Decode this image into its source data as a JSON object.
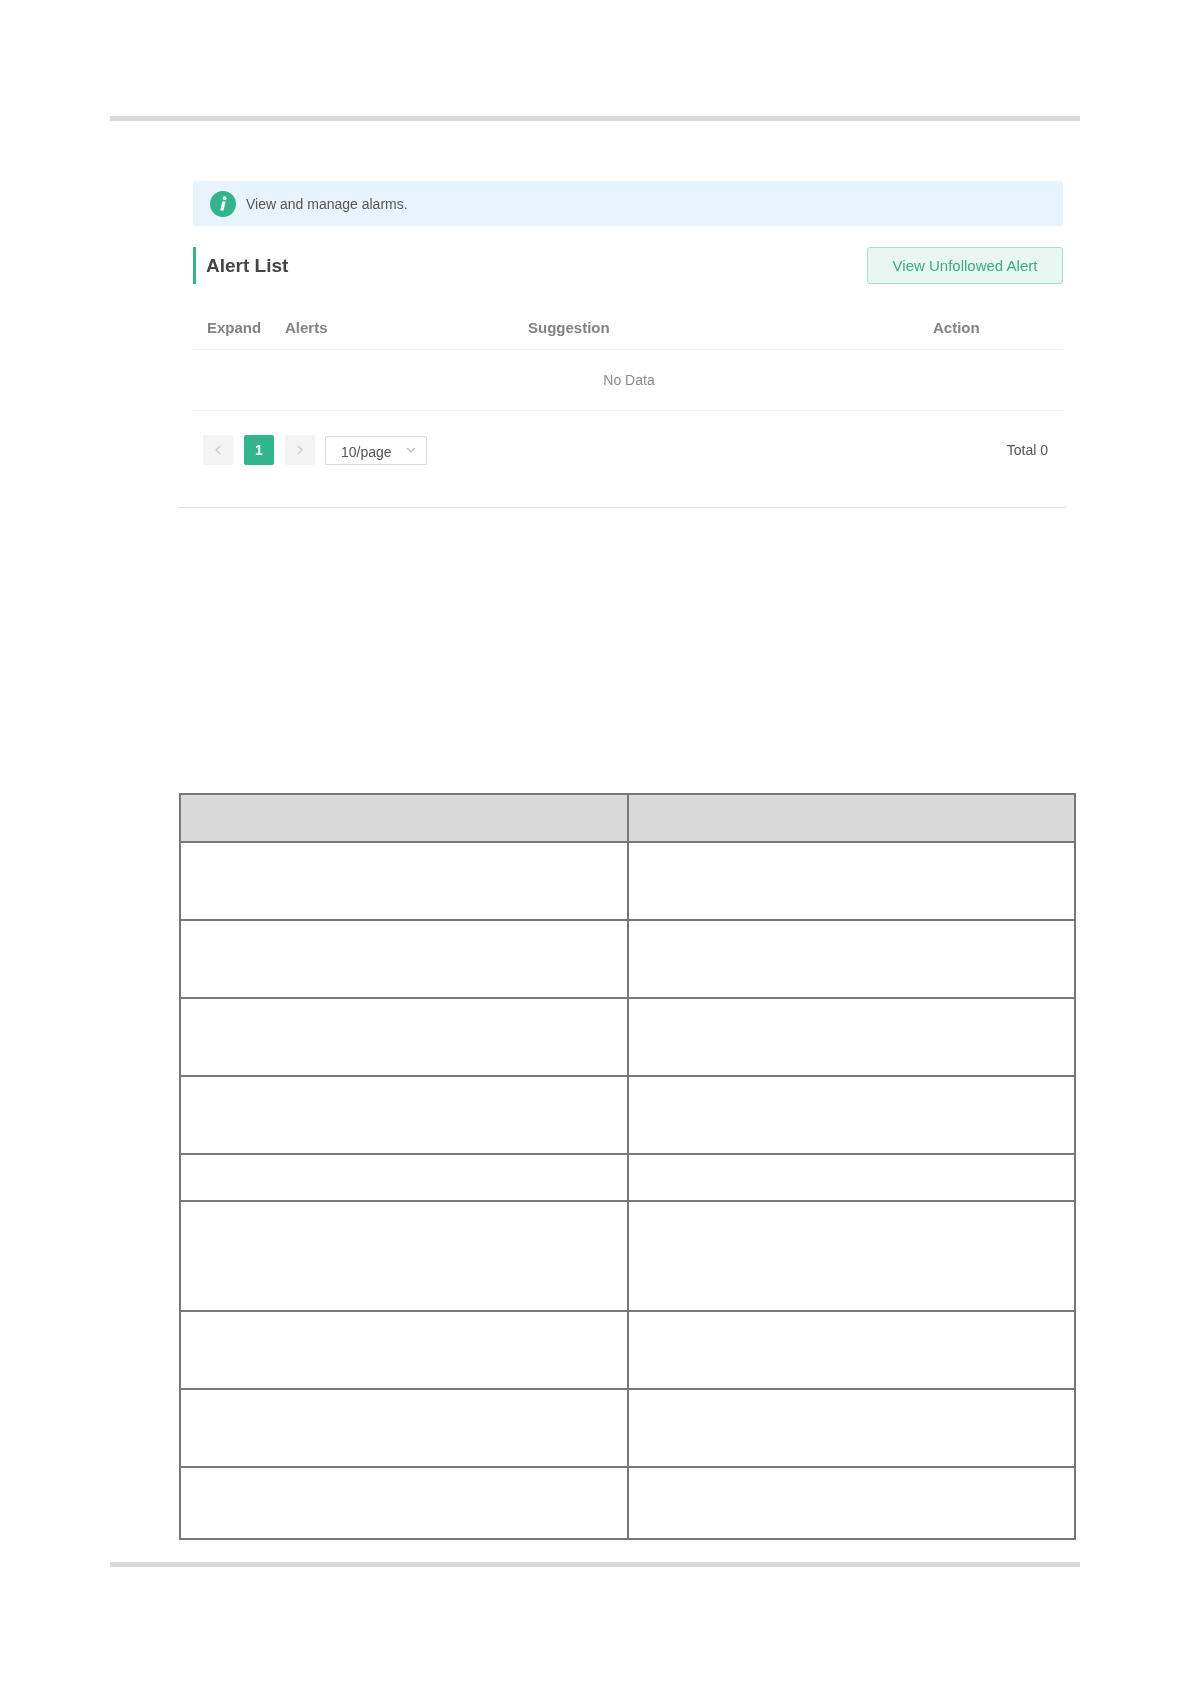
{
  "info_banner": {
    "text": "View and manage alarms."
  },
  "alert_list": {
    "title": "Alert List",
    "action_button": "View Unfollowed Alert",
    "table": {
      "columns": [
        "Expand",
        "Alerts",
        "Suggestion",
        "Action"
      ],
      "empty_text": "No Data"
    },
    "pagination": {
      "prev": {
        "disabled": true
      },
      "pages": [
        {
          "label": "1",
          "selected": true
        }
      ],
      "next": {
        "disabled": true
      },
      "page_size": "10/page",
      "total": "Total 0"
    }
  },
  "blank_table": {
    "rows": [
      {
        "kind": "header"
      },
      {
        "kind": "regular"
      },
      {
        "kind": "regular"
      },
      {
        "kind": "regular"
      },
      {
        "kind": "regular"
      },
      {
        "kind": "short"
      },
      {
        "kind": "tall"
      },
      {
        "kind": "regular"
      },
      {
        "kind": "regular"
      },
      {
        "kind": "compact"
      }
    ]
  }
}
